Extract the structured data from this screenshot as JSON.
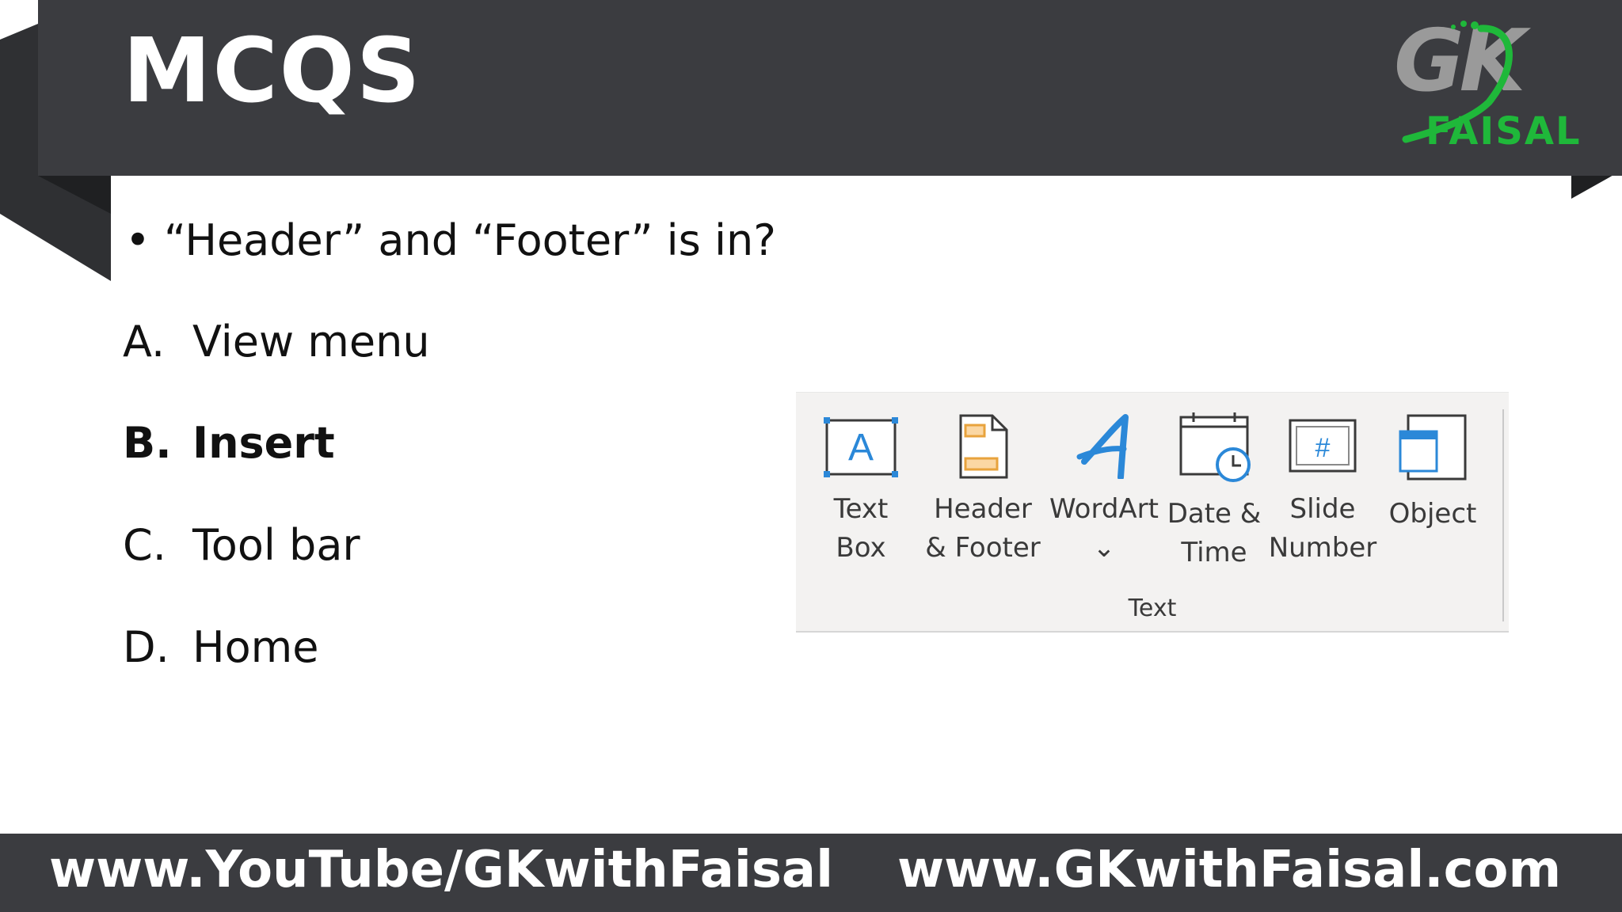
{
  "header": {
    "title": "MCQS",
    "logo": {
      "mark": "GK",
      "name": "FAISAL",
      "colors": {
        "mark": "#9a9a9a",
        "name": "#1fb83a"
      }
    }
  },
  "question": {
    "bullet": "•",
    "text": "“Header” and “Footer” is in?",
    "options": [
      {
        "letter": "A.",
        "text": "View menu",
        "highlighted": false
      },
      {
        "letter": "B.",
        "text": "Insert",
        "highlighted": true
      },
      {
        "letter": "C.",
        "text": "Tool bar",
        "highlighted": false
      },
      {
        "letter": "D.",
        "text": "Home",
        "highlighted": false
      }
    ]
  },
  "ribbon": {
    "group_label": "Text",
    "buttons": [
      {
        "icon": "text-box-icon",
        "line1": "Text",
        "line2": "Box"
      },
      {
        "icon": "header-footer-icon",
        "line1": "Header",
        "line2": "& Footer"
      },
      {
        "icon": "wordart-icon",
        "line1": "WordArt",
        "line2": "⌄"
      },
      {
        "icon": "date-time-icon",
        "line1": "Date &",
        "line2": "Time"
      },
      {
        "icon": "slide-number-icon",
        "line1": "Slide",
        "line2": "Number"
      },
      {
        "icon": "object-icon",
        "line1": "Object",
        "line2": ""
      }
    ]
  },
  "footer": {
    "youtube": "www.YouTube/GKwithFaisal",
    "website": "www.GKwithFaisal.com"
  },
  "colors": {
    "banner": "#3b3c40",
    "accent_blue": "#2b88d8",
    "accent_orange": "#e8a33d"
  }
}
